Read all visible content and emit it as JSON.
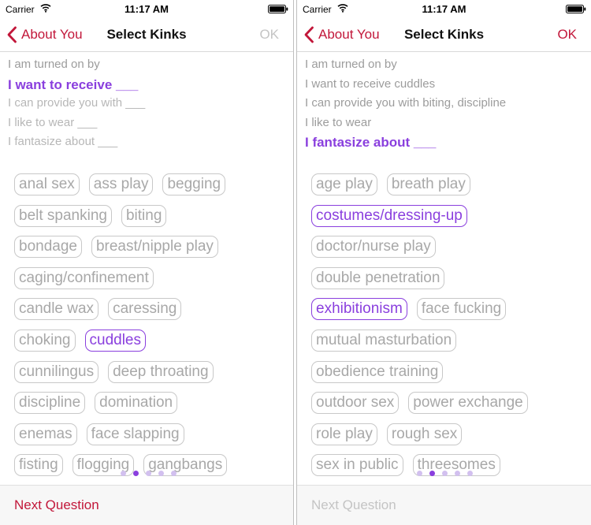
{
  "screens": [
    {
      "status": {
        "carrier": "Carrier",
        "time": "11:17 AM"
      },
      "nav": {
        "back_label": "About You",
        "title": "Select Kinks",
        "ok_label": "OK",
        "ok_enabled": false
      },
      "prompts": [
        {
          "text": "I am turned on by",
          "state": "normal"
        },
        {
          "text": "I want to receive ___",
          "state": "active"
        },
        {
          "text": "I can provide you with ___",
          "state": "faint"
        },
        {
          "text": "I like to wear ___",
          "state": "faint"
        },
        {
          "text": "I fantasize about ___",
          "state": "faint"
        }
      ],
      "tag_rows": [
        [
          {
            "label": "anal sex",
            "selected": false
          },
          {
            "label": "ass play",
            "selected": false
          },
          {
            "label": "begging",
            "selected": false
          }
        ],
        [
          {
            "label": "belt spanking",
            "selected": false
          },
          {
            "label": "biting",
            "selected": false
          }
        ],
        [
          {
            "label": "bondage",
            "selected": false
          },
          {
            "label": "breast/nipple play",
            "selected": false
          }
        ],
        [
          {
            "label": "caging/confinement",
            "selected": false
          }
        ],
        [
          {
            "label": "candle wax",
            "selected": false
          },
          {
            "label": "caressing",
            "selected": false
          }
        ],
        [
          {
            "label": "choking",
            "selected": false
          },
          {
            "label": "cuddles",
            "selected": true
          }
        ],
        [
          {
            "label": "cunnilingus",
            "selected": false
          },
          {
            "label": "deep throating",
            "selected": false
          }
        ],
        [
          {
            "label": "discipline",
            "selected": false
          },
          {
            "label": "domination",
            "selected": false
          }
        ],
        [
          {
            "label": "enemas",
            "selected": false
          },
          {
            "label": "face slapping",
            "selected": false
          }
        ],
        [
          {
            "label": "fisting",
            "selected": false
          },
          {
            "label": "flogging",
            "selected": false
          },
          {
            "label": "gangbangs",
            "selected": false
          }
        ]
      ],
      "page_dots": {
        "count": 5,
        "active_index": 1
      },
      "footer": {
        "next_label": "Next Question",
        "next_enabled": true
      }
    },
    {
      "status": {
        "carrier": "Carrier",
        "time": "11:17 AM"
      },
      "nav": {
        "back_label": "About You",
        "title": "Select Kinks",
        "ok_label": "OK",
        "ok_enabled": true
      },
      "prompts": [
        {
          "text": "I am turned on by",
          "state": "normal"
        },
        {
          "text": "I want to receive cuddles",
          "state": "normal"
        },
        {
          "text": "I can provide you with biting, discipline",
          "state": "normal"
        },
        {
          "text": "I like to wear",
          "state": "normal"
        },
        {
          "text": "I fantasize about ___",
          "state": "active"
        }
      ],
      "tag_rows": [
        [
          {
            "label": "age play",
            "selected": false
          },
          {
            "label": "breath play",
            "selected": false
          }
        ],
        [
          {
            "label": "costumes/dressing-up",
            "selected": true
          }
        ],
        [
          {
            "label": "doctor/nurse play",
            "selected": false
          }
        ],
        [
          {
            "label": "double penetration",
            "selected": false
          }
        ],
        [
          {
            "label": "exhibitionism",
            "selected": true
          },
          {
            "label": "face fucking",
            "selected": false
          }
        ],
        [
          {
            "label": "mutual masturbation",
            "selected": false
          }
        ],
        [
          {
            "label": "obedience training",
            "selected": false
          }
        ],
        [
          {
            "label": "outdoor sex",
            "selected": false
          },
          {
            "label": "power exchange",
            "selected": false
          }
        ],
        [
          {
            "label": "role play",
            "selected": false
          },
          {
            "label": "rough sex",
            "selected": false
          }
        ],
        [
          {
            "label": "sex in public",
            "selected": false
          },
          {
            "label": "threesomes",
            "selected": false
          }
        ]
      ],
      "page_dots": {
        "count": 5,
        "active_index": 1
      },
      "footer": {
        "next_label": "Next Question",
        "next_enabled": false
      }
    }
  ],
  "icons": {
    "back": "chevron-left-icon",
    "wifi": "wifi-icon",
    "battery": "battery-icon"
  },
  "colors": {
    "accent": "#8a3fde",
    "brand_red": "#c2173a",
    "disabled": "#c4c4c4",
    "tag_border": "#c8c8c8",
    "tag_text": "#a8a8a8",
    "prompt_text": "#9c9c9c"
  }
}
